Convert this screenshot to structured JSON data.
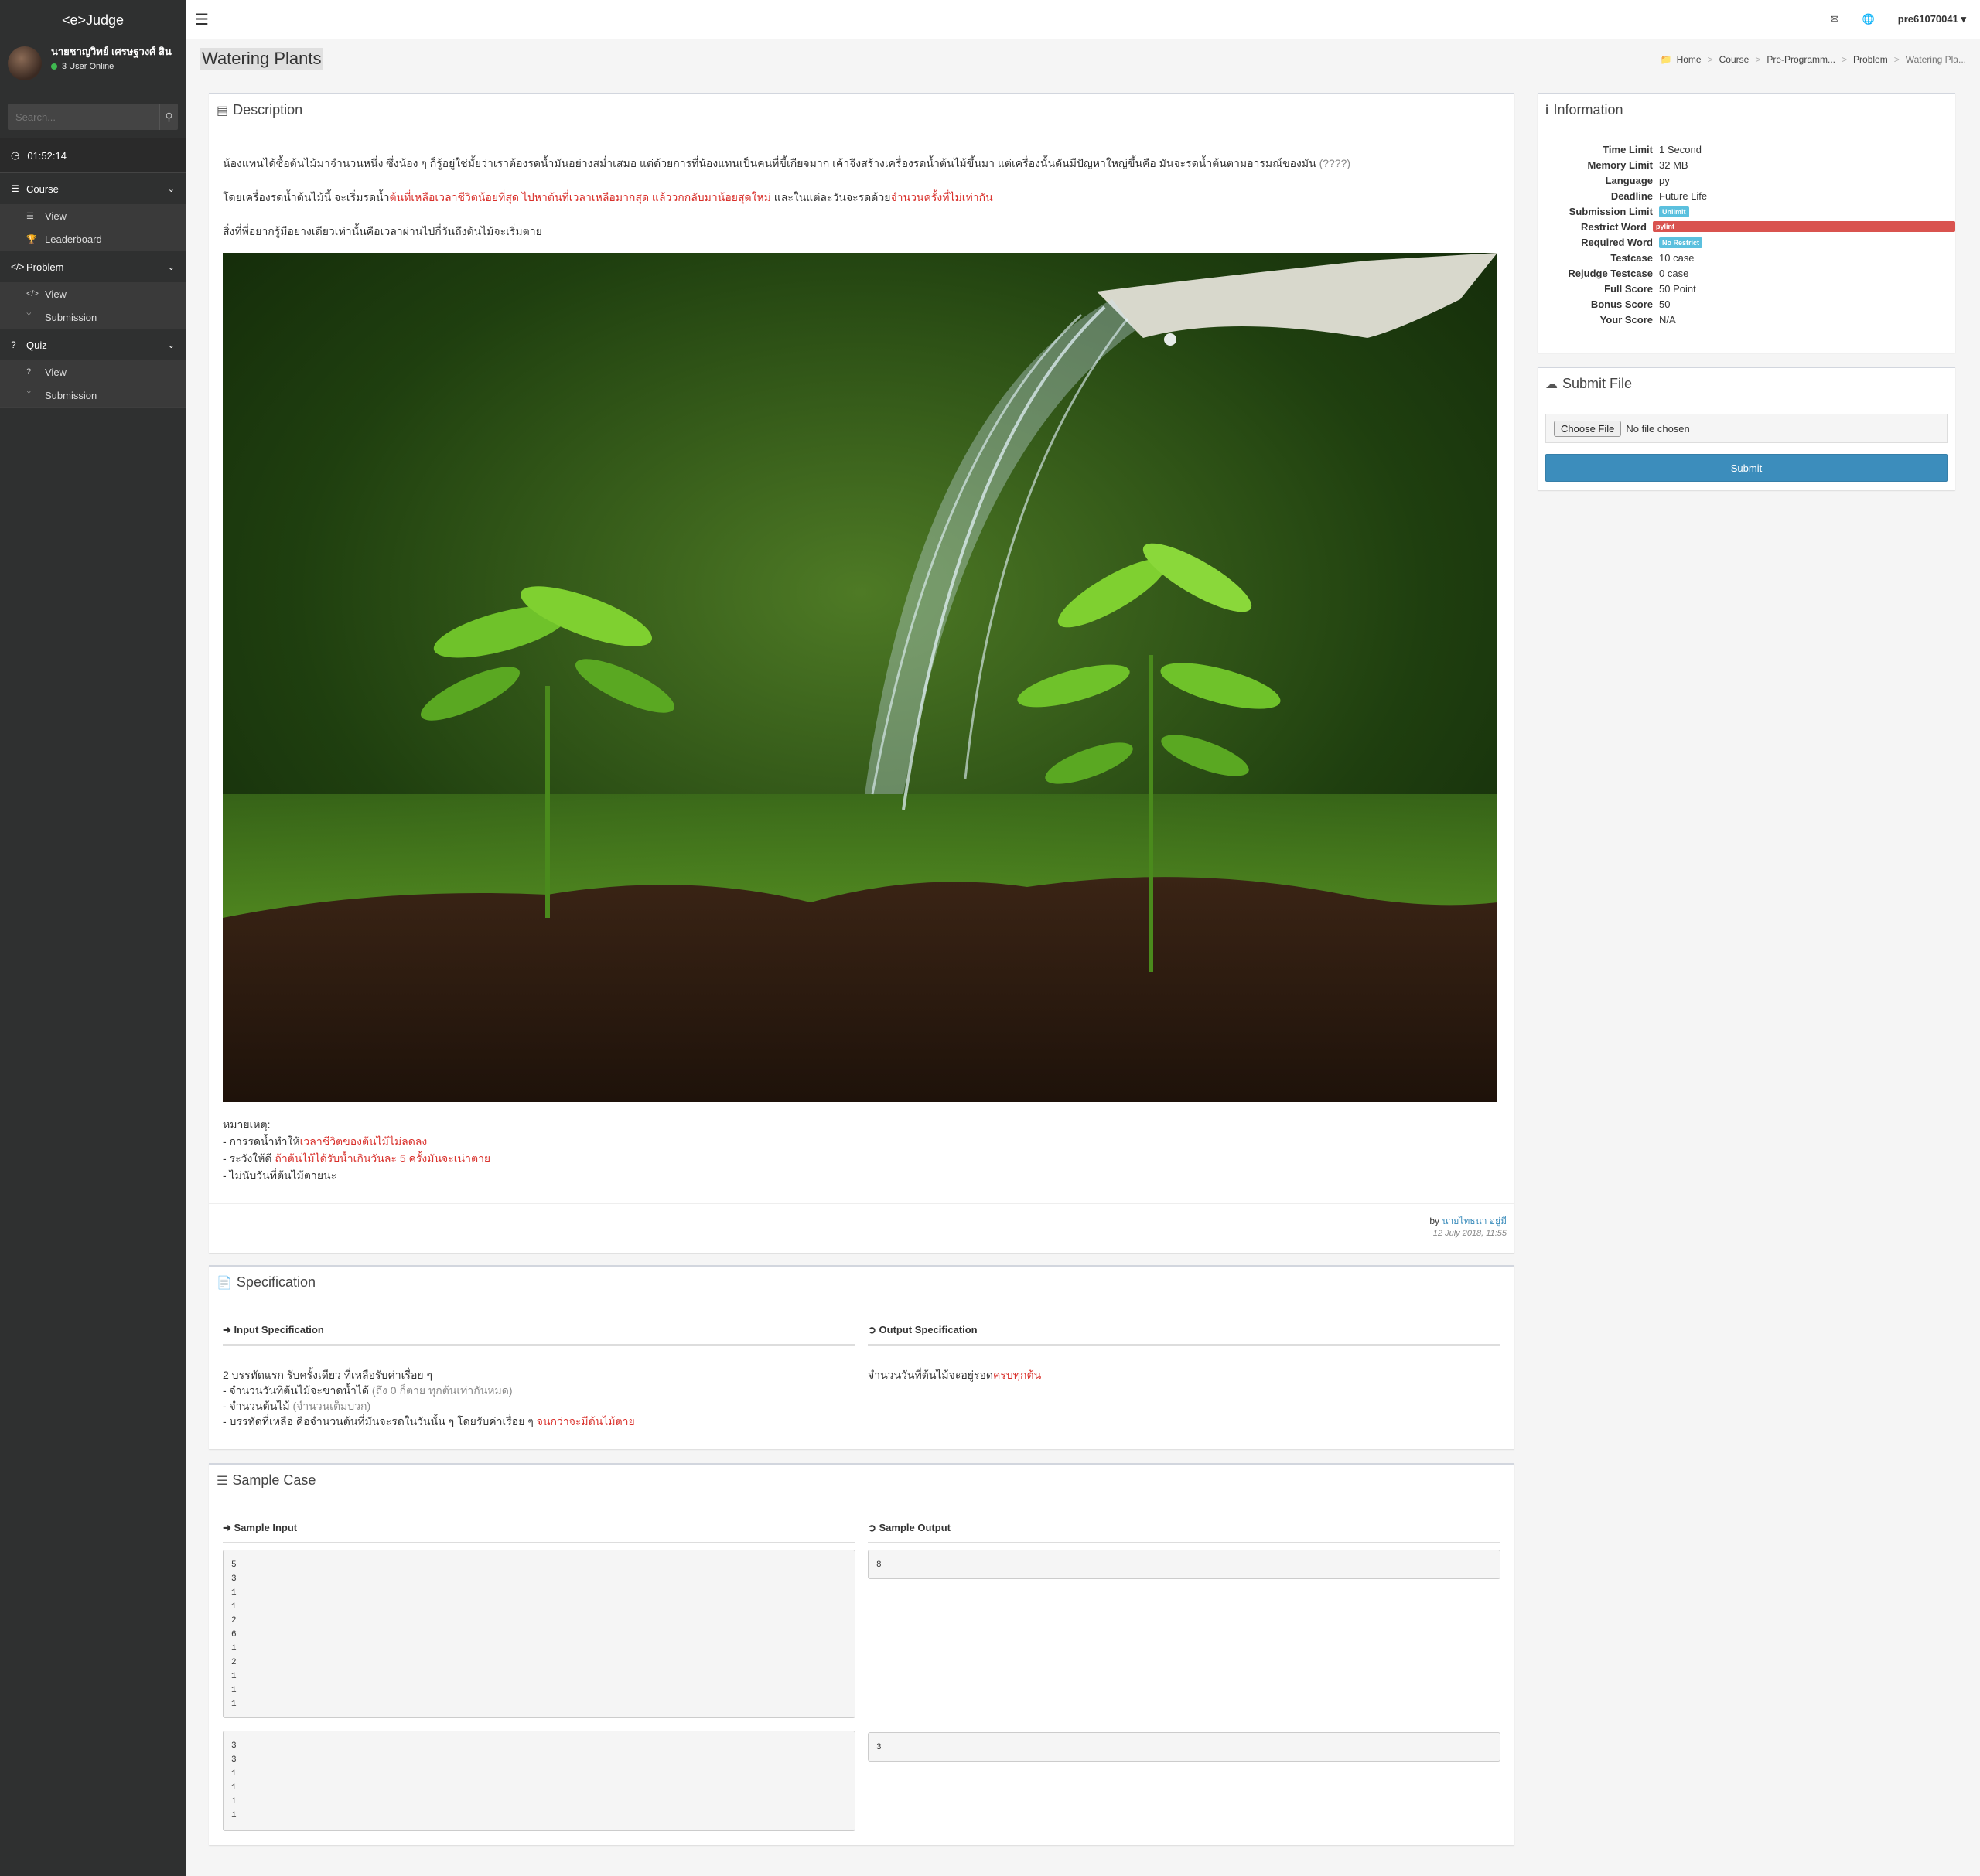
{
  "sidebar": {
    "brand": "<e>Judge",
    "user_name": "นายชาญวิทย์ เศรษฐวงศ์ สิน",
    "online": "3 User Online",
    "search_placeholder": "Search...",
    "timer": "01:52:14",
    "groups": [
      {
        "label": "Course",
        "items": [
          {
            "label": "View"
          },
          {
            "label": "Leaderboard"
          }
        ]
      },
      {
        "label": "Problem",
        "items": [
          {
            "label": "View"
          },
          {
            "label": "Submission"
          }
        ]
      },
      {
        "label": "Quiz",
        "items": [
          {
            "label": "View"
          },
          {
            "label": "Submission"
          }
        ]
      }
    ]
  },
  "topbar": {
    "user": "pre61070041 ▾"
  },
  "page": {
    "title": "Watering Plants",
    "breadcrumb": [
      "Home",
      "Course",
      "Pre-Programm...",
      "Problem",
      "Watering Pla..."
    ]
  },
  "description": {
    "title": "Description",
    "p1": "น้องแทนได้ซื้อต้นไม้มาจำนวนหนึ่ง ซึ่งน้อง ๆ ก็รู้อยู่ใช่มั้ยว่าเราต้องรดน้ำมันอย่างสม่ำเสมอ แต่ด้วยการที่น้องแทนเป็นคนที่ขี้เกียจมาก เค้าจึงสร้างเครื่องรดน้ำต้นไม้ขึ้นมา แต่เครื่องนั้นดันมีปัญหาใหญ่ขึ้นคือ มันจะรดน้ำต้นตามอารมณ์ของมัน",
    "p1_tail": "(????)",
    "p2_a": "โดยเครื่องรดน้ำต้นไม้นี้ จะเริ่มรดน้ำ",
    "p2_b": "ต้นที่เหลือเวลาชีวิตน้อยที่สุด ไปหาต้นที่เวลาเหลือมากสุด แล้ววกกลับมาน้อยสุดใหม่",
    "p2_c": " และในแต่ละวันจะรดด้วย",
    "p2_d": "จำนวนครั้งที่ไม่เท่ากัน",
    "p3": "สิ่งที่พี่อยากรู้มีอย่างเดียวเท่านั้นคือเวลาผ่านไปกี่วันถึงต้นไม้จะเริ่มตาย",
    "note_head": "หมายเหตุ:",
    "n1_a": "- การรดน้ำทำให้",
    "n1_b": "เวลาชีวิตของต้นไม้ไม่ลดลง",
    "n2_a": "- ระวังให้ดี ",
    "n2_b": "ถ้าต้นไม้ได้รับน้ำเกินวันละ 5 ครั้งมันจะเน่าตาย",
    "n3": "- ไม่นับวันที่ต้นไม้ตายนะ",
    "by": "by ",
    "author": "นายไทธนา อยู่มี",
    "date": "12 July 2018, 11:55"
  },
  "specification": {
    "title": "Specification",
    "input_head": "Input Specification",
    "output_head": "Output Specification",
    "in1": "2 บรรทัดแรก รับครั้งเดียว ที่เหลือรับค่าเรื่อย ๆ",
    "in2_a": "- จำนวนวันที่ต้นไม้จะขาดน้ำได้ ",
    "in2_b": "(ถึง 0 ก็ตาย ทุกต้นเท่ากันหมด)",
    "in3_a": "- จำนวนต้นไม้ ",
    "in3_b": "(จำนวนเต็มบวก)",
    "in4_a": "- บรรทัดที่เหลือ คือจำนวนต้นที่มันจะรดในวันนั้น ๆ โดยรับค่าเรื่อย ๆ ",
    "in4_b": "จนกว่าจะมีต้นไม้ตาย",
    "out_a": "จำนวนวันที่ต้นไม้จะอยู่รอด",
    "out_b": "ครบทุกต้น"
  },
  "samples": {
    "title": "Sample Case",
    "input_head": "Sample Input",
    "output_head": "Sample Output",
    "cases": [
      {
        "input": "5\n3\n1\n1\n2\n6\n1\n2\n1\n1\n1",
        "output": "8"
      },
      {
        "input": "3\n3\n1\n1\n1\n1",
        "output": "3"
      }
    ]
  },
  "information": {
    "title": "Information",
    "rows": [
      {
        "k": "Time Limit",
        "v": "1 Second"
      },
      {
        "k": "Memory Limit",
        "v": "32 MB"
      },
      {
        "k": "Language",
        "v": "py"
      },
      {
        "k": "Deadline",
        "v": "Future Life"
      },
      {
        "k": "Submission Limit",
        "v": "Unlimit"
      },
      {
        "k": "Restrict Word",
        "v": "pylint"
      },
      {
        "k": "Required Word",
        "v": "No Restrict"
      },
      {
        "k": "Testcase",
        "v": "10 case"
      },
      {
        "k": "Rejudge Testcase",
        "v": "0 case"
      },
      {
        "k": "Full Score",
        "v": "50 Point"
      },
      {
        "k": "Bonus Score",
        "v": "50"
      },
      {
        "k": "Your Score",
        "v": "N/A"
      }
    ]
  },
  "submit": {
    "title": "Submit File",
    "choose": "Choose File",
    "no_file": "No file chosen",
    "button": "Submit"
  },
  "colors": {
    "sidebar": "#2f3030",
    "accent": "#3c8dbc",
    "danger": "#d9534f",
    "info": "#5bc0de"
  }
}
